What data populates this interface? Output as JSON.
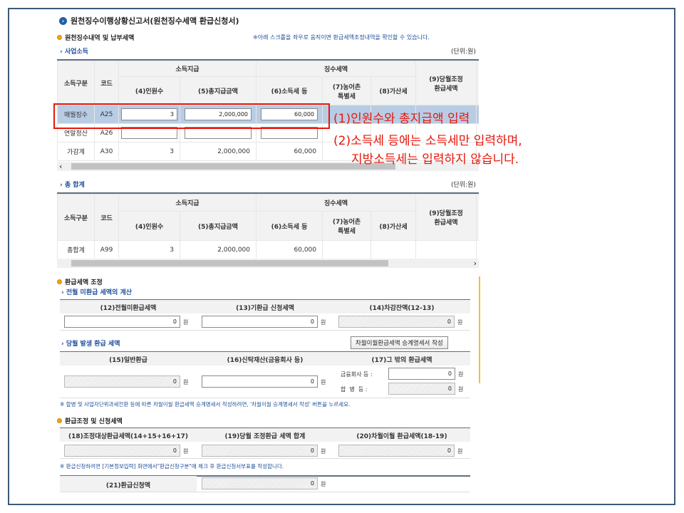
{
  "title": "원천징수이행상황신고서(원천징수세액 환급신청서)",
  "section1": {
    "heading": "원천징수내역 및 납부세액",
    "note": "※아래 스크롤을 좌우로 움직이면 환급세액조정내역을 확인할 수 있습니다.",
    "subheading": "사업소득",
    "unit": "(단위:원)",
    "headers": {
      "category": "소득구분",
      "code": "코드",
      "income_group": "소득지급",
      "tax_group": "징수세액",
      "col4": "(4)인원수",
      "col5": "(5)총지급금액",
      "col6": "(6)소득세 등",
      "col7_line1": "(7)농어촌",
      "col7_line2": "특별세",
      "col8": "(8)가산세",
      "col9_line1": "(9)당월조정",
      "col9_line2": "환급세액"
    },
    "rows": [
      {
        "category": "매월징수",
        "code": "A25",
        "people": "3",
        "total": "2,000,000",
        "tax": "60,000"
      },
      {
        "category": "연말정산",
        "code": "A26",
        "people": "",
        "total": "",
        "tax": ""
      },
      {
        "category": "가감계",
        "code": "A30",
        "people": "3",
        "total": "2,000,000",
        "tax": "60,000"
      }
    ]
  },
  "section2": {
    "subheading": "총 합계",
    "unit": "(단위:원)",
    "row": {
      "category": "총합계",
      "code": "A99",
      "people": "3",
      "total": "2,000,000",
      "tax": "60,000"
    }
  },
  "annotation": {
    "line1": "(1)인원수와 총지급액 입력",
    "line2": "(2)소득세 등에는 소득세만 입력하며,",
    "line3": "지방소득세는 입력하지 않습니다."
  },
  "section3": {
    "heading": "환급세액 조정",
    "sub1": "전월 미환급 세액의 계산",
    "col12": "(12)전월미환급세액",
    "col13": "(13)기환급 신청세액",
    "col14": "(14)차감잔액(12-13)",
    "sub2": "당월 발생 환급 세액",
    "button": "차월이월환급세액 승계명세서 작성",
    "col15": "(15)일반환급",
    "col16": "(16)신탁재산(금융회사 등)",
    "col17": "(17)그 밖의 환급세액",
    "label_fin": "금융회사 등 :",
    "label_merge": "합  병  등 :",
    "note": "※ 합병 및 사업자단위과세전환 등에 따른 차월이월 환급세액 승계명세서 작성하려면, '차월이월 승계명세서 작성' 버튼을 누르세요."
  },
  "section4": {
    "heading": "환급조정 및 신청세액",
    "col18": "(18)조정대상환급세액(14+15+16+17)",
    "col19": "(19)당월 조정환급 세액 합계",
    "col20": "(20)차월이월 환급세액(18-19)",
    "note": "※ 환급신청하려면 [기본정보입력] 화면에서\"환급신청구분\"에 체크 후 환급신청서부표를 작성합니다.",
    "col21": "(21)환급신청액"
  },
  "zero": "0",
  "won": "원",
  "colors": {
    "highlight_row": "#b8cce4",
    "annotation": "#e8160a",
    "frame": "#3c5a7a",
    "link": "#1f4e9a"
  }
}
